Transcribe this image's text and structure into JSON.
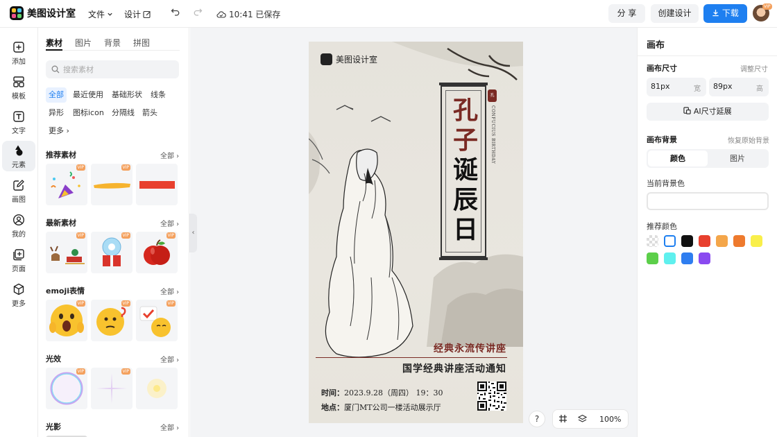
{
  "topbar": {
    "app_name": "美图设计室",
    "menu_file": "文件",
    "menu_design": "设计",
    "save_status": "10:41 已保存",
    "share_label": "分 享",
    "create_label": "创建设计",
    "download_label": "下载",
    "avatar_badge": "VIP"
  },
  "rail": {
    "items": [
      {
        "label": "添加",
        "icon": "plus-square-icon"
      },
      {
        "label": "模板",
        "icon": "template-icon"
      },
      {
        "label": "文字",
        "icon": "text-icon"
      },
      {
        "label": "元素",
        "icon": "shapes-icon"
      },
      {
        "label": "画图",
        "icon": "edit-icon"
      },
      {
        "label": "我的",
        "icon": "user-icon"
      },
      {
        "label": "页面",
        "icon": "page-add-icon"
      },
      {
        "label": "更多",
        "icon": "cube-icon"
      }
    ]
  },
  "panel": {
    "tabs": [
      "素材",
      "图片",
      "背景",
      "拼图"
    ],
    "search_placeholder": "搜索素材",
    "chips": [
      "全部",
      "最近使用",
      "基础形状",
      "线条",
      "异形",
      "图标icon",
      "分隔线",
      "箭头",
      "更多"
    ],
    "all_label": "全部",
    "vip_label": "VIP",
    "sections": [
      {
        "title": "推荐素材"
      },
      {
        "title": "最新素材"
      },
      {
        "title": "emoji表情"
      },
      {
        "title": "光效"
      },
      {
        "title": "光影"
      }
    ]
  },
  "poster": {
    "logo_text": "美图设计室",
    "title_chars": [
      "孔",
      "子",
      "诞",
      "辰",
      "日"
    ],
    "seal_text": "孔",
    "english_vertical": "CONFUCIUS BIRTHDAY",
    "subtitle1": "经典永流传讲座",
    "subtitle2": "国学经典讲座活动通知",
    "time_label": "时间：",
    "time_value": "2023.9.28（周四） 19：30",
    "place_label": "地点：",
    "place_value": "厦门MT公司一楼活动展示厅"
  },
  "canvas_controls": {
    "help": "?",
    "zoom": "100%"
  },
  "right_panel": {
    "title": "画布",
    "size_label": "画布尺寸",
    "resize_link": "调整尺寸",
    "width_value": "81px",
    "width_unit": "宽",
    "height_value": "89px",
    "height_unit": "高",
    "ai_extend_label": "AI尺寸延展",
    "bg_label": "画布背景",
    "restore_link": "恢复原始背景",
    "seg_color": "颜色",
    "seg_image": "图片",
    "current_bg_label": "当前背景色",
    "recommend_label": "推荐颜色",
    "swatches": [
      "transparent",
      "#ffffff",
      "#111111",
      "#e8402e",
      "#f4a64a",
      "#ee7a2e",
      "#f9ef4a",
      "#5ccf4a",
      "#5ff0ee",
      "#2f7ef0",
      "#8a4af0"
    ]
  }
}
